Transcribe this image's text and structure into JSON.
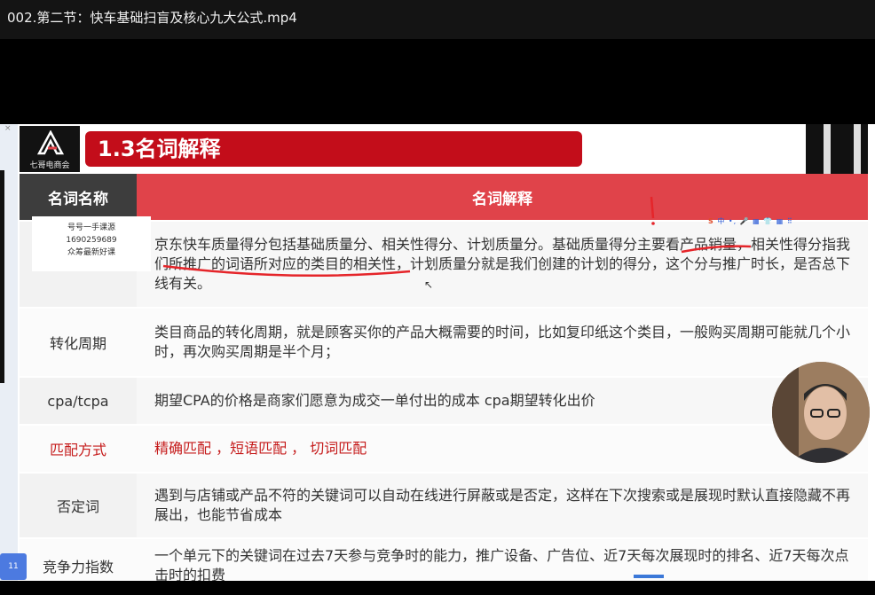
{
  "window": {
    "title": "002.第二节：快车基础扫盲及核心九大公式.mp4"
  },
  "slide": {
    "logo_caption": "七哥电商会",
    "section_title": "1.3名词解释",
    "table": {
      "headers": [
        "名词名称",
        "名词解释"
      ],
      "rows": [
        {
          "term": "",
          "desc": "京东快车质量得分包括基础质量分、相关性得分、计划质量分。基础质量得分主要看产品销量，相关性得分指我们所推广的词语所对应的类目的相关性，计划质量分就是我们创建的计划的得分，这个分与推广时长，是否总下线有关。"
        },
        {
          "term": "转化周期",
          "desc": "类目商品的转化周期，就是顾客买你的产品大概需要的时间，比如复印纸这个类目，一般购买周期可能就几个小时，再次购买周期是半个月；"
        },
        {
          "term": "cpa/tcpa",
          "desc": "期望CPA的价格是商家们愿意为成交一单付出的成本    cpa期望转化出价"
        },
        {
          "term": "匹配方式",
          "desc": "精确匹配 ，短语匹配 ，  切词匹配",
          "highlight": true
        },
        {
          "term": "否定词",
          "desc": "遇到与店铺或产品不符的关键词可以自动在线进行屏蔽或是否定，这样在下次搜索或是展现时默认直接隐藏不再展出，也能节省成本"
        },
        {
          "term": "竞争力指数",
          "desc": "一个单元下的关键词在过去7天参与竞争时的能力，推广设备、广告位、近7天每次展现时的排名、近7天每次点击时的扣费"
        }
      ]
    },
    "watermark": {
      "line1": "号号一手课源",
      "line2": "1690259689",
      "line3": "众筹最新好课"
    },
    "ime_toolbar": {
      "logo": "S",
      "items": "中 •, 🎤 ▦ 👕 ▦ ⠿"
    }
  },
  "overlay": {
    "badge_text": "11"
  },
  "colors": {
    "banner_red": "#c30d1a",
    "header_red": "#e0434a",
    "header_dark": "#3d3d3d",
    "annotation_red": "#e5252a"
  }
}
